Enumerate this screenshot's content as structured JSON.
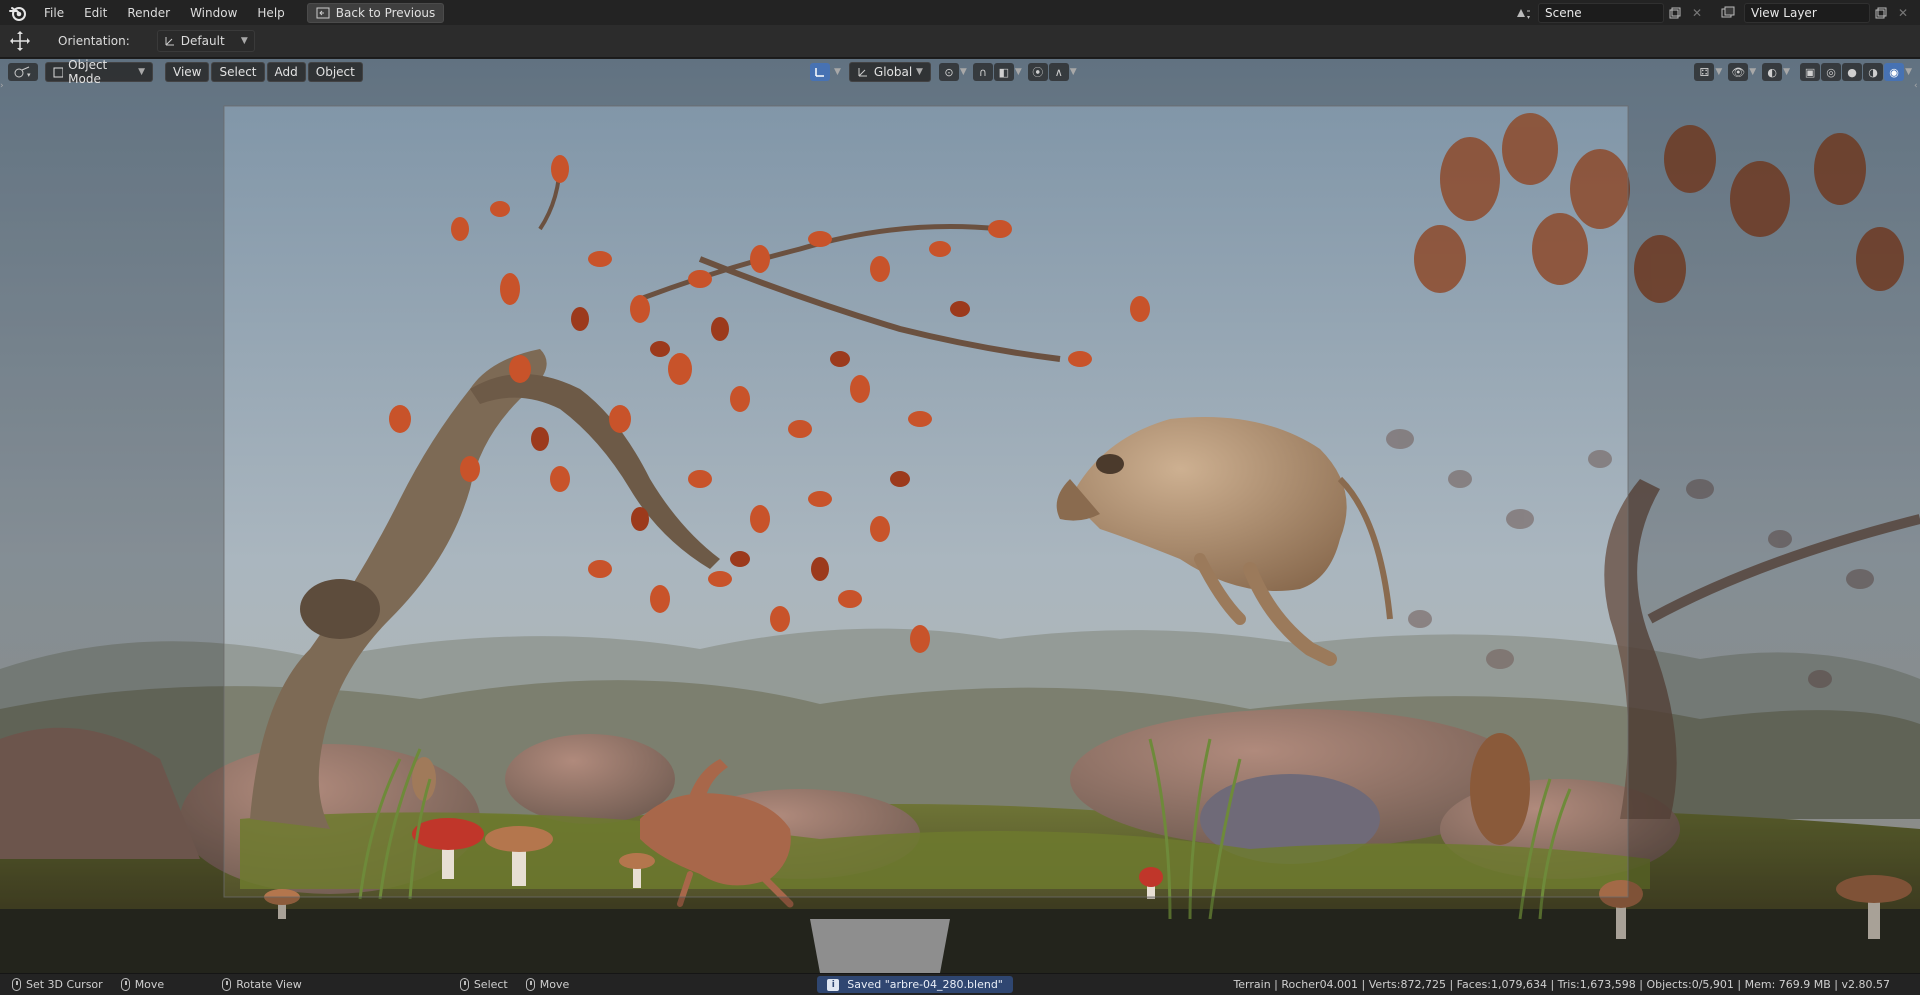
{
  "topbar": {
    "menus": [
      "File",
      "Edit",
      "Render",
      "Window",
      "Help"
    ],
    "back_button": "Back to Previous",
    "scene_value": "Scene",
    "view_layer_value": "View Layer"
  },
  "tool_header": {
    "orientation_label": "Orientation:",
    "orientation_value": "Default"
  },
  "viewport_header": {
    "mode": "Object Mode",
    "menus": [
      "View",
      "Select",
      "Add",
      "Object"
    ],
    "transform_orientation": "Global"
  },
  "statusbar": {
    "set_cursor": "Set 3D Cursor",
    "move1": "Move",
    "rotate_view": "Rotate View",
    "select": "Select",
    "move2": "Move",
    "saved_message": "Saved \"arbre-04_280.blend\"",
    "stats": "Terrain | Rocher04.001 | Verts:872,725 | Faces:1,079,634 | Tris:1,673,598 | Objects:0/5,901 | Mem: 769.9 MB | v2.80.57"
  },
  "colors": {
    "accent": "#4772b3",
    "leaf_orange": "#c8532a",
    "sky": "#8ea3b4"
  }
}
